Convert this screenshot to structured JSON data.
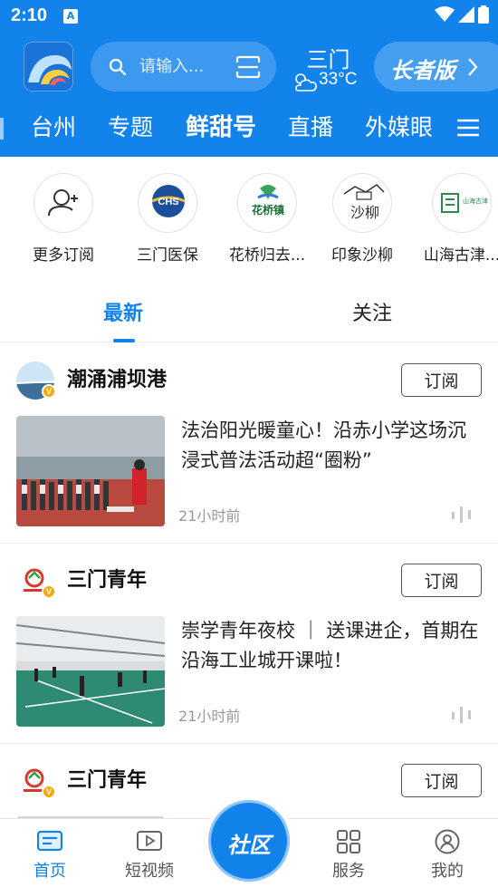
{
  "status_bar": {
    "time": "2:10",
    "notification_badge": "A"
  },
  "app_bar": {
    "search_placeholder": "请输入...",
    "weather": {
      "city": "三门",
      "temperature": "33°C"
    },
    "elder_mode_label": "长者版"
  },
  "nav_tabs": [
    {
      "label": "台州",
      "active": false
    },
    {
      "label": "专题",
      "active": false
    },
    {
      "label": "鲜甜号",
      "active": true
    },
    {
      "label": "直播",
      "active": false
    },
    {
      "label": "外媒眼",
      "active": false
    }
  ],
  "subscriptions": [
    {
      "label": "更多订阅"
    },
    {
      "label": "三门医保"
    },
    {
      "label": "花桥归去..."
    },
    {
      "label": "印象沙柳"
    },
    {
      "label": "山海古津..."
    }
  ],
  "subscription_logo_text": {
    "chs": "CHS",
    "huaqiao": "花桥镇",
    "shaliu": "沙柳",
    "shanhai": "山海古津"
  },
  "feed_tabs": [
    {
      "label": "最新",
      "active": true
    },
    {
      "label": "关注",
      "active": false
    }
  ],
  "feed": [
    {
      "source": "潮涌浦坝港",
      "subscribe_label": "订阅",
      "headline": "法治阳光暖童心！沿赤小学这场沉浸式普法活动超“圈粉”",
      "time": "21小时前"
    },
    {
      "source": "三门青年",
      "subscribe_label": "订阅",
      "headline": "崇学青年夜校 ｜ 送课进企，首期在沿海工业城开课啦！",
      "time": "21小时前"
    },
    {
      "source": "三门青年",
      "subscribe_label": "订阅",
      "headline": "",
      "time": ""
    }
  ],
  "bottom_nav": [
    {
      "label": "首页",
      "active": true
    },
    {
      "label": "短视频",
      "active": false
    },
    {
      "label": "服务",
      "active": false
    },
    {
      "label": "我的",
      "active": false
    }
  ],
  "community_label": "社区",
  "colors": {
    "primary": "#1383ec",
    "verified": "#f4a90e"
  }
}
